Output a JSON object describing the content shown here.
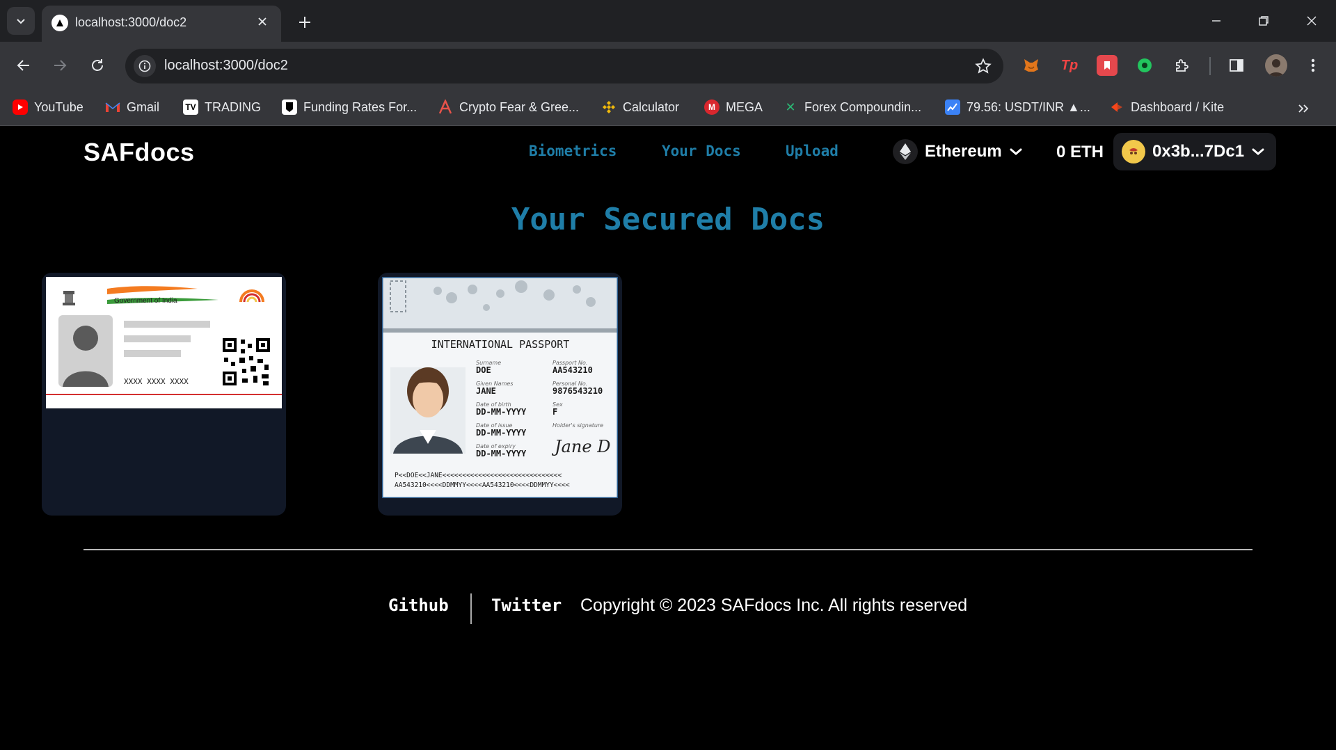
{
  "browser": {
    "tab_title": "localhost:3000/doc2",
    "url": "localhost:3000/doc2",
    "bookmarks": [
      {
        "label": "YouTube",
        "icon": "youtube-icon",
        "color": "#ff0000"
      },
      {
        "label": "Gmail",
        "icon": "gmail-icon",
        "color": "#ea4335"
      },
      {
        "label": "TRADING",
        "icon": "tradingview-icon",
        "color": "#ffffff"
      },
      {
        "label": "Funding Rates For...",
        "icon": "funding-rates-icon",
        "color": "#ffffff"
      },
      {
        "label": "Crypto Fear & Gree...",
        "icon": "fear-greed-icon",
        "color": "#e8534a"
      },
      {
        "label": "Calculator",
        "icon": "binance-icon",
        "color": "#f0b90b"
      },
      {
        "label": "MEGA",
        "icon": "mega-icon",
        "color": "#d9272e"
      },
      {
        "label": "Forex Compoundin...",
        "icon": "forex-icon",
        "color": "#2bb673"
      },
      {
        "label": "79.56: USDT/INR ▲...",
        "icon": "chart-icon",
        "color": "#3b82f6"
      },
      {
        "label": "Dashboard / Kite",
        "icon": "kite-icon",
        "color": "#f6461a"
      }
    ]
  },
  "app": {
    "brand": "SAFdocs",
    "nav": {
      "biometrics": "Biometrics",
      "your_docs": "Your Docs",
      "upload": "Upload"
    },
    "network": "Ethereum",
    "balance": "0 ETH",
    "account": "0x3b...7Dc1",
    "accent_color": "#1f7ea8"
  },
  "main": {
    "title": "Your Secured Docs",
    "docs": [
      {
        "kind": "aadhaar",
        "header_text": "Government of India",
        "number": "XXXX XXXX XXXX"
      },
      {
        "kind": "passport",
        "heading": "INTERNATIONAL PASSPORT",
        "surname_label": "Surname",
        "surname": "DOE",
        "given_label": "Given Names",
        "given": "JANE",
        "passport_no_label": "Passport No.",
        "passport_no": "AA543210",
        "personal_no_label": "Personal No.",
        "personal_no": "9876543210",
        "dob_label": "Date of birth",
        "dob": "DD-MM-YYYY",
        "sex_label": "Sex",
        "sex": "F",
        "issue_label": "Date of issue",
        "issue": "DD-MM-YYYY",
        "expiry_label": "Date of expiry",
        "expiry": "DD-MM-YYYY",
        "signature_label": "Holder's signature",
        "signature": "Jane D",
        "mrz1": "P<<DOE<<JANE<<<<<<<<<<<<<<<<<<<<<<<<<<<<<<",
        "mrz2": "AA543210<<<<DDMMYY<<<<AA543210<<<<DDMMYY<<<<"
      }
    ]
  },
  "footer": {
    "github": "Github",
    "twitter": "Twitter",
    "copyright": "Copyright © 2023 SAFdocs Inc. All rights reserved"
  }
}
